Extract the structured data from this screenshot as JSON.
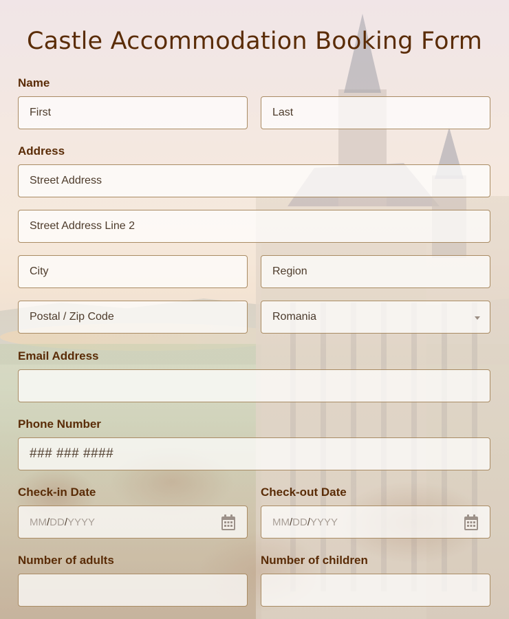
{
  "form_title": "Castle Accommodation Booking Form",
  "name": {
    "label": "Name",
    "first_placeholder": "First",
    "last_placeholder": "Last"
  },
  "address": {
    "label": "Address",
    "street_placeholder": "Street Address",
    "street2_placeholder": "Street Address Line 2",
    "city_placeholder": "City",
    "region_placeholder": "Region",
    "postal_placeholder": "Postal / Zip Code",
    "country_selected": "Romania"
  },
  "email": {
    "label": "Email Address",
    "value": ""
  },
  "phone": {
    "label": "Phone Number",
    "placeholder": "### ### ####"
  },
  "checkin": {
    "label": "Check-in Date",
    "mm": "MM",
    "dd": "DD",
    "yyyy": "YYYY",
    "sep": "/"
  },
  "checkout": {
    "label": "Check-out Date",
    "mm": "MM",
    "dd": "DD",
    "yyyy": "YYYY",
    "sep": "/"
  },
  "adults": {
    "label": "Number of adults",
    "value": ""
  },
  "children": {
    "label": "Number of children",
    "value": ""
  },
  "colors": {
    "accent_brown": "#5a2c07",
    "field_border": "#a98b63"
  },
  "icons": {
    "date_picker": "calendar-icon",
    "country_dropdown": "chevron-down-icon"
  }
}
